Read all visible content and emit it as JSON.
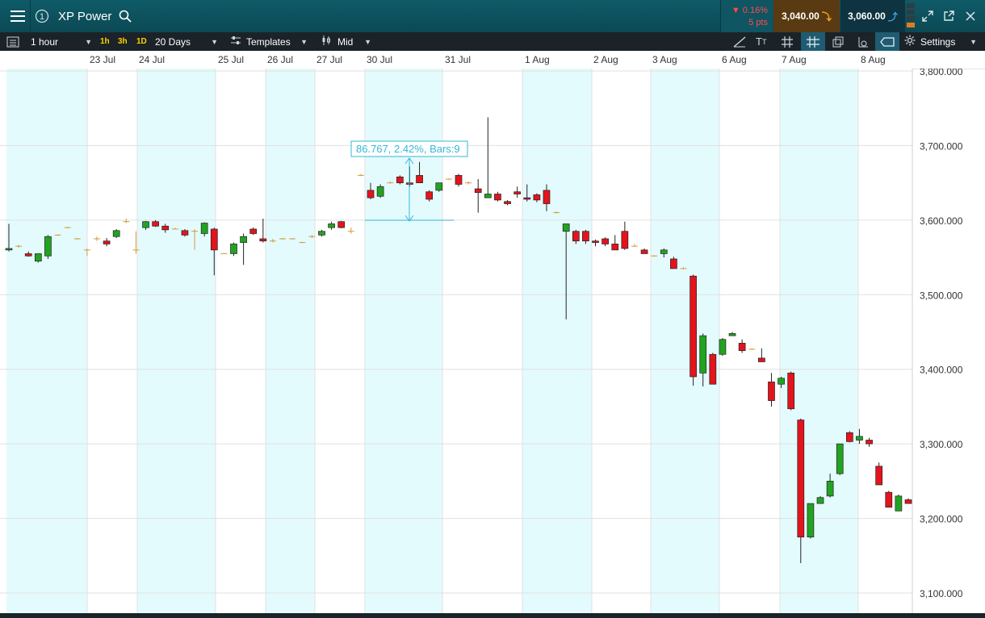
{
  "header": {
    "instrument": "XP Power",
    "change_percent": "0.16%",
    "change_points": "5 pts",
    "sell_price": "3,040.00",
    "buy_price": "3,060.00",
    "colors": {
      "bar": "#0c5260",
      "sell_bg": "#5a3a12",
      "buy_bg": "#0d3440",
      "down": "#ff3b3b"
    }
  },
  "toolbar": {
    "interval": "1 hour",
    "quick_1h": "1h",
    "quick_3h": "3h",
    "quick_1d": "1D",
    "range": "20 Days",
    "templates": "Templates",
    "price_type": "Mid",
    "settings": "Settings"
  },
  "date_axis": [
    "23 Jul",
    "24 Jul",
    "25 Jul",
    "26 Jul",
    "27 Jul",
    "30 Jul",
    "31 Jul",
    "1 Aug",
    "2 Aug",
    "3 Aug",
    "6 Aug",
    "7 Aug",
    "8 Aug"
  ],
  "measure_label": "86.767, 2.42%, Bars:9",
  "chart_data": {
    "type": "candlestick",
    "title": "",
    "y_tick_labels": [
      "3,800.000",
      "3,700.000",
      "3,600.000",
      "3,500.000",
      "3,400.000",
      "3,300.000",
      "3,200.000",
      "3,100.000"
    ],
    "y_ticks": [
      3800,
      3700,
      3600,
      3500,
      3400,
      3300,
      3200,
      3100
    ],
    "ylim": [
      3090,
      3805
    ],
    "x_tick_labels": [
      "23 Jul",
      "24 Jul",
      "25 Jul",
      "26 Jul",
      "27 Jul",
      "30 Jul",
      "31 Jul",
      "1 Aug",
      "2 Aug",
      "3 Aug",
      "6 Aug",
      "7 Aug",
      "8 Aug"
    ],
    "up_color": "#22a322",
    "down_color": "#e3141c",
    "candles": [
      [
        3560,
        3595,
        3558,
        3562
      ],
      [
        3565,
        3567,
        3563,
        3565
      ],
      [
        3555,
        3558,
        3551,
        3552
      ],
      [
        3545,
        3555,
        3543,
        3555
      ],
      [
        3552,
        3580,
        3548,
        3578
      ],
      [
        3580,
        3581,
        3579,
        3580
      ],
      [
        3590,
        3591,
        3589,
        3590
      ],
      [
        3575,
        3576,
        3574,
        3575
      ],
      [
        3560,
        3562,
        3552,
        3560
      ],
      [
        3575,
        3578,
        3572,
        3575
      ],
      [
        3572,
        3576,
        3565,
        3568
      ],
      [
        3578,
        3588,
        3576,
        3586
      ],
      [
        3598,
        3602,
        3596,
        3599
      ],
      [
        3560,
        3585,
        3555,
        3560
      ],
      [
        3590,
        3599,
        3587,
        3598
      ],
      [
        3598,
        3600,
        3591,
        3592
      ],
      [
        3592,
        3595,
        3583,
        3587
      ],
      [
        3588,
        3590,
        3588,
        3588
      ],
      [
        3586,
        3588,
        3578,
        3580
      ],
      [
        3585,
        3588,
        3560,
        3585
      ],
      [
        3582,
        3597,
        3578,
        3596
      ],
      [
        3588,
        3590,
        3526,
        3560
      ],
      [
        3555,
        3556,
        3555,
        3555
      ],
      [
        3555,
        3570,
        3552,
        3568
      ],
      [
        3570,
        3582,
        3540,
        3578
      ],
      [
        3588,
        3590,
        3580,
        3582
      ],
      [
        3575,
        3602,
        3570,
        3572
      ],
      [
        3572,
        3575,
        3570,
        3571
      ],
      [
        3575,
        3576,
        3574,
        3575
      ],
      [
        3575,
        3576,
        3574,
        3575
      ],
      [
        3570,
        3571,
        3569,
        3570
      ],
      [
        3578,
        3580,
        3576,
        3578
      ],
      [
        3580,
        3587,
        3578,
        3585
      ],
      [
        3590,
        3598,
        3587,
        3595
      ],
      [
        3598,
        3599,
        3589,
        3590
      ],
      [
        3585,
        3590,
        3582,
        3585
      ],
      [
        3660,
        3662,
        3659,
        3660
      ],
      [
        3640,
        3650,
        3628,
        3630
      ],
      [
        3632,
        3648,
        3630,
        3645
      ],
      [
        3650,
        3652,
        3649,
        3650
      ],
      [
        3658,
        3660,
        3648,
        3650
      ],
      [
        3650,
        3672,
        3645,
        3648
      ],
      [
        3660,
        3678,
        3650,
        3650
      ],
      [
        3638,
        3640,
        3625,
        3628
      ],
      [
        3640,
        3650,
        3638,
        3650
      ],
      [
        3655,
        3656,
        3654,
        3655
      ],
      [
        3660,
        3662,
        3645,
        3648
      ],
      [
        3650,
        3652,
        3648,
        3650
      ],
      [
        3642,
        3655,
        3610,
        3637
      ],
      [
        3630,
        3738,
        3630,
        3635
      ],
      [
        3635,
        3638,
        3625,
        3627
      ],
      [
        3625,
        3627,
        3620,
        3622
      ],
      [
        3638,
        3645,
        3630,
        3635
      ],
      [
        3630,
        3648,
        3625,
        3628
      ],
      [
        3634,
        3636,
        3624,
        3627
      ],
      [
        3640,
        3648,
        3612,
        3622
      ],
      [
        3610,
        3612,
        3609,
        3610
      ],
      [
        3585,
        3595,
        3467,
        3595
      ],
      [
        3585,
        3587,
        3568,
        3572
      ],
      [
        3585,
        3587,
        3568,
        3572
      ],
      [
        3572,
        3574,
        3565,
        3570
      ],
      [
        3575,
        3577,
        3565,
        3568
      ],
      [
        3568,
        3580,
        3560,
        3560
      ],
      [
        3585,
        3598,
        3560,
        3562
      ],
      [
        3565,
        3568,
        3564,
        3565
      ],
      [
        3560,
        3562,
        3555,
        3555
      ],
      [
        3552,
        3553,
        3551,
        3552
      ],
      [
        3555,
        3562,
        3550,
        3560
      ],
      [
        3548,
        3551,
        3535,
        3535
      ],
      [
        3535,
        3537,
        3534,
        3535
      ],
      [
        3525,
        3527,
        3378,
        3390
      ],
      [
        3395,
        3448,
        3377,
        3445
      ],
      [
        3420,
        3422,
        3380,
        3380
      ],
      [
        3420,
        3442,
        3418,
        3440
      ],
      [
        3445,
        3450,
        3445,
        3448
      ],
      [
        3435,
        3440,
        3422,
        3425
      ],
      [
        3427,
        3428,
        3426,
        3427
      ],
      [
        3415,
        3428,
        3410,
        3410
      ],
      [
        3383,
        3395,
        3350,
        3358
      ],
      [
        3380,
        3390,
        3375,
        3388
      ],
      [
        3395,
        3397,
        3345,
        3347
      ],
      [
        3332,
        3334,
        3140,
        3175
      ],
      [
        3175,
        3220,
        3173,
        3220
      ],
      [
        3220,
        3230,
        3220,
        3228
      ],
      [
        3230,
        3260,
        3228,
        3250
      ],
      [
        3260,
        3300,
        3258,
        3300
      ],
      [
        3315,
        3317,
        3302,
        3303
      ],
      [
        3305,
        3320,
        3300,
        3310
      ],
      [
        3305,
        3308,
        3296,
        3300
      ],
      [
        3270,
        3275,
        3245,
        3245
      ],
      [
        3235,
        3237,
        3215,
        3215
      ],
      [
        3210,
        3232,
        3210,
        3230
      ],
      [
        3225,
        3227,
        3220,
        3220
      ]
    ]
  }
}
